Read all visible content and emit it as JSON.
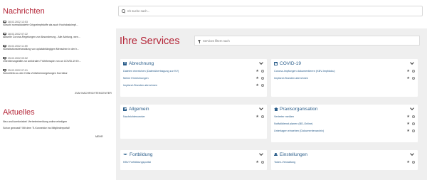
{
  "news": {
    "title": "Nachrichten",
    "items": [
      {
        "date": "28.02.2022 12:53",
        "text": "Sowohl normaldosierte Grippeimpfstoffe als auch Hochdosisimpf..."
      },
      {
        "date": "28.02.2022 07:22",
        "text": "Aktuelle Corona-Regelungen zur Absonderung - Alle Achtung, wen..."
      },
      {
        "date": "25.02.2022 11:59",
        "text": "Substitutionsbehandlung von opiatabhängigen Menschen in der h..."
      },
      {
        "date": "25.02.2022 09:52",
        "text": "Orientierungshilfe zur antiviralen Frühtherapie von an COVID-19 Er..."
      },
      {
        "date": "25.02.2022 07:01",
        "text": "Schnellinfo zu den Kritis-Verfahrensregelungen Korrektur"
      }
    ],
    "all_label": "ZUM NACHRICHTENCENTER"
  },
  "updates": {
    "title": "Aktuelles",
    "lines": [
      "Neu und komfortabel: Vertreterimeldung online erledigen",
      "Schon gewusst? Mit dem TI-Konnektor ins Mitgliederportal!"
    ],
    "more_label": "MEHR"
  },
  "search": {
    "placeholder": "Ich suche nach..."
  },
  "services": {
    "title": "Ihre Services",
    "filter_placeholder": "Services filtern nach",
    "cards": [
      {
        "title": "Abrechnung",
        "icon": "calculator-icon",
        "items": [
          "Dateien einreichen (Datenübertragung zur KV)",
          "Meine Einreichungen",
          "Impfarzt-Stunden abrechnen"
        ]
      },
      {
        "title": "COVID-19",
        "icon": "calendar-icon",
        "items": [
          "Corona-Impfungen dokumentieren (KBV-Impfdoku)",
          "Impfarzt-Stunden abrechnen"
        ]
      },
      {
        "title": "Allgemein",
        "icon": "checkbox-icon",
        "items": [
          "Nachrichtencenter"
        ]
      },
      {
        "title": "Praxisorganisation",
        "icon": "house-icon",
        "items": [
          "Vertreter melden",
          "Notfalldienst planen (BD-Online)",
          "Unterlagen einsehen (Dokumentenarchiv)"
        ]
      },
      {
        "title": "Fortbildung",
        "icon": "graduation-cap-icon",
        "items": [
          "KBV-Fortbildungsportal"
        ]
      },
      {
        "title": "Einstellungen",
        "icon": "user-icon",
        "items": [
          "Token-Verwaltung"
        ]
      }
    ]
  },
  "colors": {
    "accent": "#b5283a",
    "link": "#2a5d8a",
    "panel_bg": "#efefef"
  }
}
